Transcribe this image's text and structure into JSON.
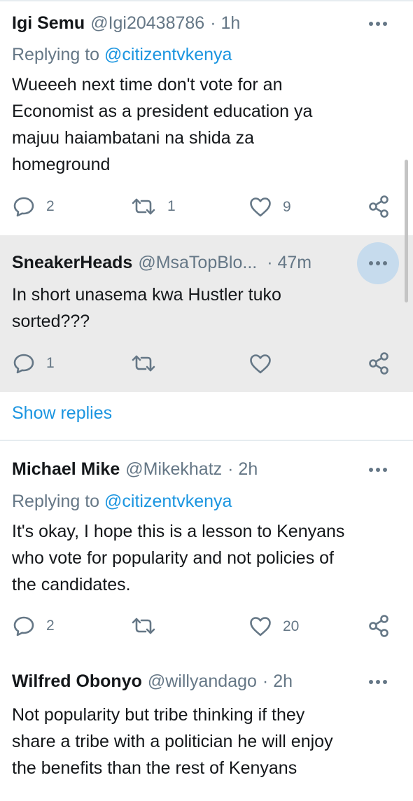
{
  "tweets": [
    {
      "name": "Igi Semu",
      "handle": "@Igi20438786",
      "time": "· 1h",
      "replying_prefix": "Replying to ",
      "replying_to": "@citizentvkenya",
      "lines": [
        "Wueeeh next time don't vote for an",
        "Economist as a president education ya",
        "majuu haiambatani na shida za",
        "homeground"
      ],
      "replies": "2",
      "retweets": "1",
      "likes": "9"
    },
    {
      "name": "SneakerHeads",
      "handle": "@MsaTopBlo...",
      "time": "· 47m",
      "lines": [
        "In short unasema kwa Hustler tuko",
        "sorted???"
      ],
      "replies": "1",
      "retweets": "",
      "likes": ""
    },
    {
      "name": "Michael Mike",
      "handle": "@Mikekhatz",
      "time": "· 2h",
      "replying_prefix": "Replying to ",
      "replying_to": "@citizentvkenya",
      "lines": [
        "It's okay, I hope this is a lesson to Kenyans",
        "who  vote for popularity and not policies of",
        "the candidates."
      ],
      "replies": "2",
      "retweets": "",
      "likes": "20"
    },
    {
      "name": "Wilfred Obonyo",
      "handle": "@willyandago",
      "time": "· 2h",
      "lines": [
        "Not popularity but tribe thinking if they",
        "share a tribe with a politician he will enjoy",
        "the benefits than the rest of Kenyans"
      ]
    }
  ],
  "show_replies": "Show replies",
  "icons": {
    "more": "more-dots-icon",
    "reply": "reply-bubble-icon",
    "retweet": "retweet-icon",
    "like": "heart-icon",
    "share": "share-icon"
  },
  "colors": {
    "link": "#1b95e0",
    "muted": "#657786",
    "highlight_bg": "#ebebeb",
    "more_active_bg": "#c6dbed"
  }
}
